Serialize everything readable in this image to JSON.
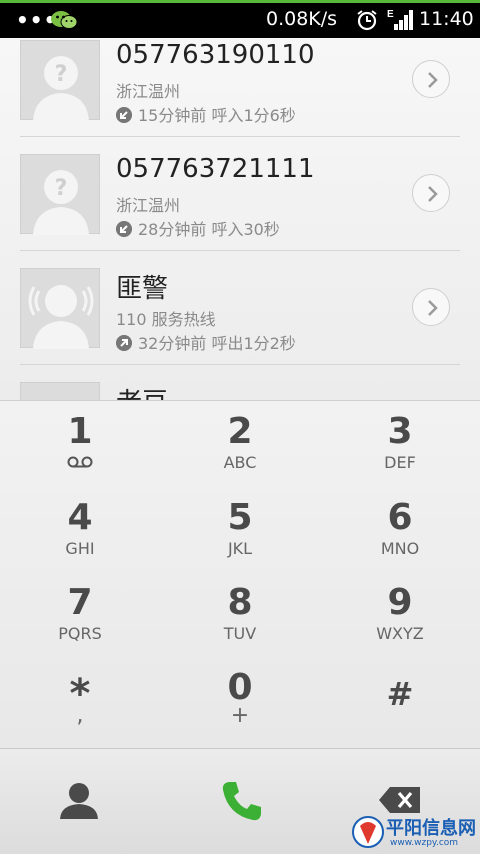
{
  "statusbar": {
    "overflow": "•••",
    "speed": "0.08K/s",
    "network": "E",
    "time": "11:40",
    "icons": [
      "wechat-icon",
      "alarm-icon",
      "signal-icon"
    ]
  },
  "calls": [
    {
      "name": "057763190110",
      "location": "浙江温州",
      "meta": "15分钟前 呼入1分6秒",
      "direction": "incoming"
    },
    {
      "name": "057763721111",
      "location": "浙江温州",
      "meta": "28分钟前 呼入30秒",
      "direction": "incoming"
    },
    {
      "name": "匪警",
      "location": "110 服务热线",
      "meta": "32分钟前 呼出1分2秒",
      "direction": "outgoing"
    },
    {
      "name": "老豆",
      "location": "",
      "meta": "",
      "direction": ""
    }
  ],
  "dialpad": [
    {
      "digit": "1",
      "letters": ""
    },
    {
      "digit": "2",
      "letters": "ABC"
    },
    {
      "digit": "3",
      "letters": "DEF"
    },
    {
      "digit": "4",
      "letters": "GHI"
    },
    {
      "digit": "5",
      "letters": "JKL"
    },
    {
      "digit": "6",
      "letters": "MNO"
    },
    {
      "digit": "7",
      "letters": "PQRS"
    },
    {
      "digit": "8",
      "letters": "TUV"
    },
    {
      "digit": "9",
      "letters": "WXYZ"
    },
    {
      "digit": "*",
      "letters": ","
    },
    {
      "digit": "0",
      "letters": "+"
    },
    {
      "digit": "#",
      "letters": ""
    }
  ],
  "bottombar": {
    "contacts": "contacts-icon",
    "call": "phone-call-icon",
    "delete": "backspace-icon"
  },
  "colors": {
    "accent": "#57b83a",
    "call_green": "#3cb034",
    "statusbar": "#000000"
  },
  "watermark": {
    "title": "平阳信息网",
    "url": "www.wzpy.com"
  }
}
